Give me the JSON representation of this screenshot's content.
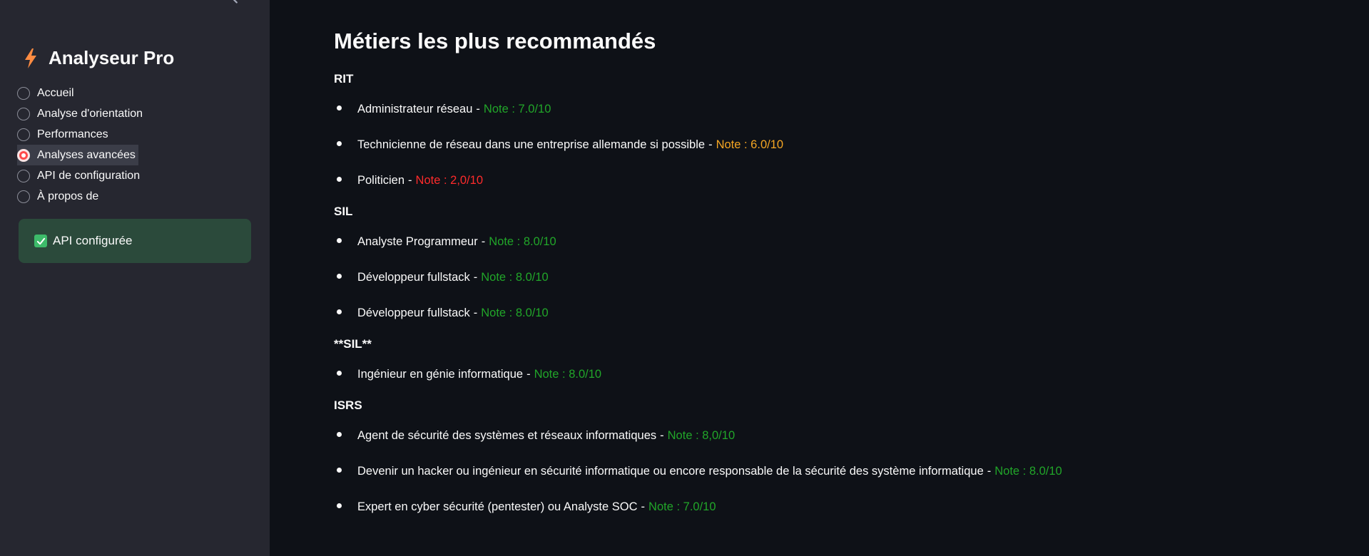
{
  "sidebar": {
    "brand_title": "Analyseur Pro",
    "brand_icon": "lightning-icon",
    "nav": [
      {
        "label": "Accueil",
        "active": false
      },
      {
        "label": "Analyse d'orientation",
        "active": false
      },
      {
        "label": "Performances",
        "active": false
      },
      {
        "label": "Analyses avancées",
        "active": true
      },
      {
        "label": "API de configuration",
        "active": false
      },
      {
        "label": "À propos de",
        "active": false
      }
    ],
    "status_text": "API configurée"
  },
  "main": {
    "title": "Métiers les plus recommandés",
    "sections": [
      {
        "heading": "RIT",
        "jobs": [
          {
            "title": "Administrateur réseau",
            "note": "Note : 7.0/10",
            "color": "green"
          },
          {
            "title": "Technicienne de réseau dans une entreprise allemande si possible",
            "note": "Note : 6.0/10",
            "color": "orange"
          },
          {
            "title": "Politicien",
            "note": "Note : 2,0/10",
            "color": "red"
          }
        ]
      },
      {
        "heading": "SIL",
        "jobs": [
          {
            "title": "Analyste Programmeur",
            "note": "Note : 8.0/10",
            "color": "green"
          },
          {
            "title": "Développeur fullstack",
            "note": "Note : 8.0/10",
            "color": "green"
          },
          {
            "title": "Développeur fullstack",
            "note": "Note : 8.0/10",
            "color": "green"
          }
        ]
      },
      {
        "heading": "**SIL**",
        "jobs": [
          {
            "title": "Ingénieur en génie informatique",
            "note": "Note : 8.0/10",
            "color": "green"
          }
        ]
      },
      {
        "heading": "ISRS",
        "jobs": [
          {
            "title": "Agent de sécurité des systèmes et réseaux informatiques",
            "note": "Note : 8,0/10",
            "color": "green"
          },
          {
            "title": "Devenir un hacker ou ingénieur en sécurité informatique ou encore responsable de la sécurité des système informatique",
            "note": "Note : 8.0/10",
            "color": "green"
          },
          {
            "title": "Expert en cyber sécurité (pentester) ou Analyste SOC",
            "note": "Note : 7.0/10",
            "color": "green"
          }
        ]
      }
    ],
    "separator": "-"
  },
  "colors": {
    "green": "#21a629",
    "orange": "#f5a623",
    "red": "#ff2b2b",
    "accent": "#ff4b4b",
    "sidebar_bg": "#262730",
    "main_bg": "#0e1117",
    "success_bg": "#2b4a3b"
  }
}
